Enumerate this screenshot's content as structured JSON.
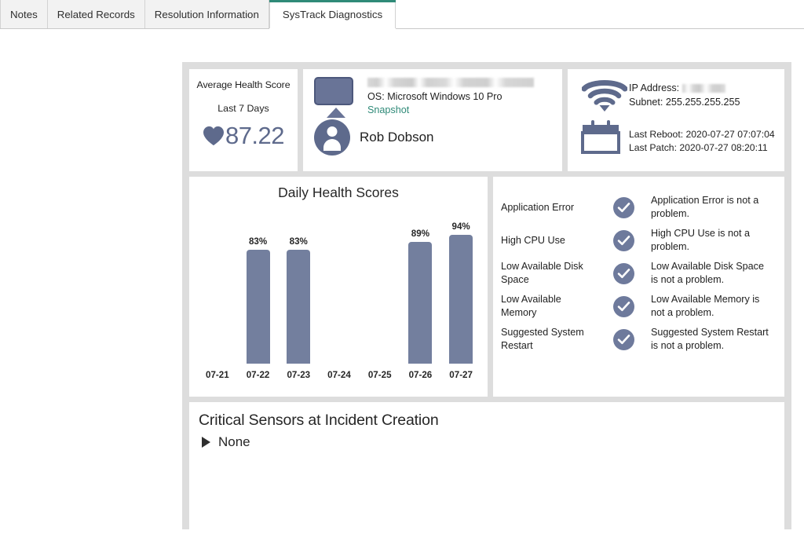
{
  "tabs": [
    {
      "label": "Notes",
      "active": false
    },
    {
      "label": "Related Records",
      "active": false
    },
    {
      "label": "Resolution Information",
      "active": false
    },
    {
      "label": "SysTrack Diagnostics",
      "active": true
    }
  ],
  "health": {
    "title": "Average Health Score",
    "period": "Last 7 Days",
    "score": "87.22",
    "heart_icon": "heart-icon",
    "accent_color": "#5e6a8c"
  },
  "machine": {
    "name_redacted": true,
    "os": "OS: Microsoft Windows 10 Pro",
    "snapshot_link": "Snapshot",
    "snapshot_color": "#2f8a78",
    "user_name": "Rob Dobson",
    "monitor_icon": "monitor-icon",
    "avatar_icon": "user-avatar-icon"
  },
  "network": {
    "wifi_icon": "wifi-icon",
    "calendar_icon": "calendar-icon",
    "ip_label": "IP Address:",
    "ip_redacted": true,
    "subnet": "Subnet: 255.255.255.255",
    "last_reboot": "Last Reboot: 2020-07-27 07:07:04",
    "last_patch": "Last Patch: 2020-07-27 08:20:11"
  },
  "chart_data": {
    "type": "bar",
    "title": "Daily Health Scores",
    "xlabel": "",
    "ylabel": "",
    "ylim": [
      0,
      100
    ],
    "grid": false,
    "legend": null,
    "bar_color": "#737f9e",
    "categories": [
      "07-21",
      "07-22",
      "07-23",
      "07-24",
      "07-25",
      "07-26",
      "07-27"
    ],
    "values": [
      null,
      83,
      83,
      null,
      null,
      89,
      94
    ],
    "data_labels": [
      "",
      "83%",
      "83%",
      "",
      "",
      "89%",
      "94%"
    ]
  },
  "checks": {
    "items": [
      {
        "name": "Application Error",
        "status_icon": "check-circle-icon",
        "message": "Application Error is not a problem."
      },
      {
        "name": "High CPU Use",
        "status_icon": "check-circle-icon",
        "message": "High CPU Use is not a problem."
      },
      {
        "name": "Low Available Disk Space",
        "status_icon": "check-circle-icon",
        "message": "Low Available Disk Space is not a problem."
      },
      {
        "name": "Low Available Memory",
        "status_icon": "check-circle-icon",
        "message": "Low Available Memory is not a problem."
      },
      {
        "name": "Suggested System Restart",
        "status_icon": "check-circle-icon",
        "message": "Suggested System Restart is not a problem."
      }
    ],
    "status_color": "#6e7a9c"
  },
  "sensors": {
    "title": "Critical Sensors at Incident Creation",
    "value": "None",
    "caret_icon": "triangle-right-icon"
  }
}
